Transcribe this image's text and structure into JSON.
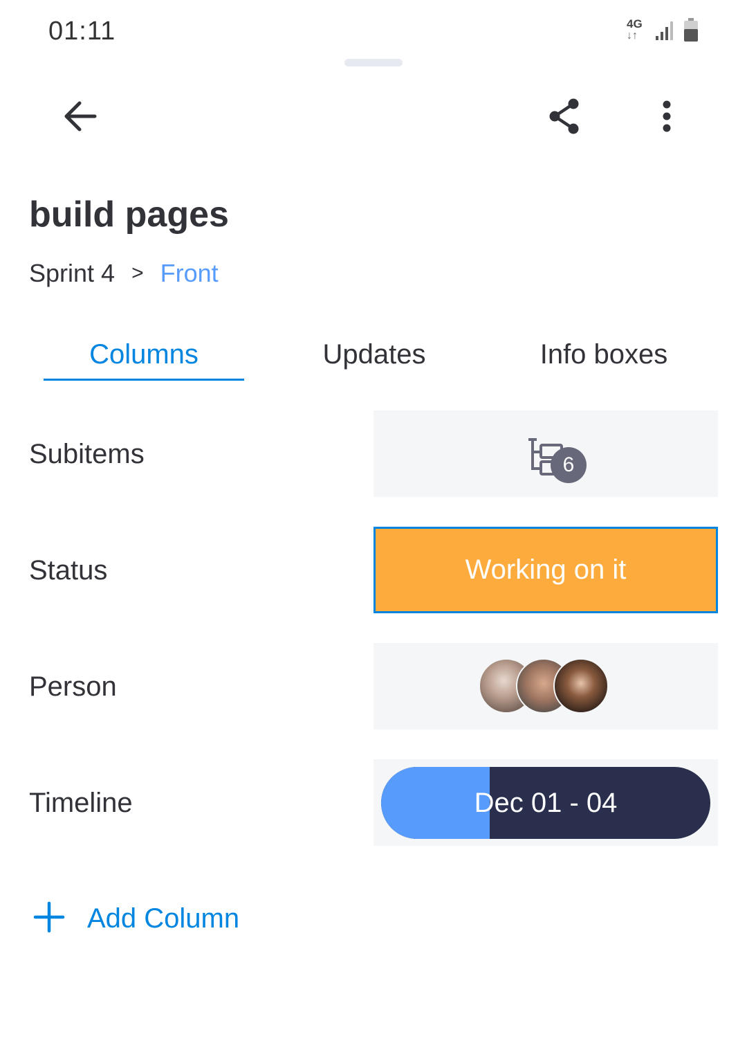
{
  "status_bar": {
    "time": "01:11",
    "network": "4G",
    "network_arrows": "↓↑"
  },
  "toolbar": {
    "back_icon": "arrow-left-icon",
    "share_icon": "share-icon",
    "more_icon": "more-vertical-icon"
  },
  "item": {
    "title": "build pages",
    "breadcrumb": {
      "board": "Sprint 4",
      "separator": ">",
      "group": "Front"
    }
  },
  "tabs": [
    {
      "label": "Columns",
      "active": true
    },
    {
      "label": "Updates",
      "active": false
    },
    {
      "label": "Info boxes",
      "active": false
    }
  ],
  "columns": {
    "subitems": {
      "label": "Subitems",
      "count": "6"
    },
    "status": {
      "label": "Status",
      "value": "Working on it",
      "color": "#fdab3d"
    },
    "person": {
      "label": "Person",
      "avatar_count": 3
    },
    "timeline": {
      "label": "Timeline",
      "value": "Dec 01 - 04",
      "progress": 0.33
    }
  },
  "add_column": {
    "label": "Add Column"
  },
  "colors": {
    "accent": "#0085e0",
    "group_blue": "#579bfc",
    "status_orange": "#fdab3d",
    "timeline_dark": "#292f4c",
    "cell_bg": "#f5f6f8"
  }
}
